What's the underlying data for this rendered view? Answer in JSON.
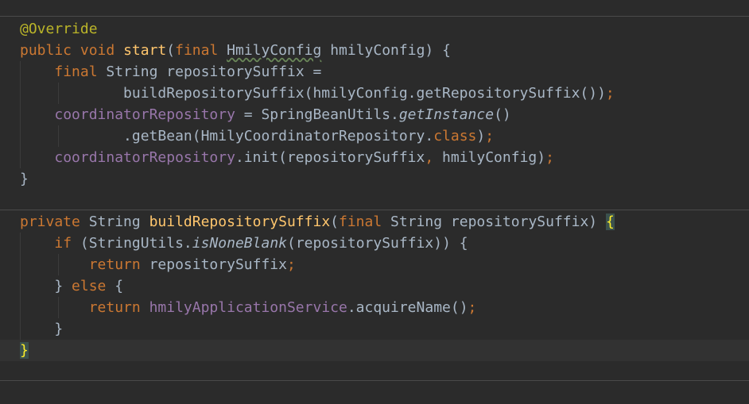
{
  "colors": {
    "background": "#2b2b2b",
    "current_line": "#323232",
    "text": "#a9b7c6",
    "keyword": "#cc7832",
    "annotation": "#bbb529",
    "method_declaration": "#ffc66d",
    "field": "#9876aa",
    "brace_match_bg": "#3b514d",
    "brace_match_fg": "#ffef28"
  },
  "code": {
    "annotation": "@Override",
    "kw_public": "public",
    "kw_void": "void",
    "start_method": "start",
    "kw_final": "final",
    "hmily_config_type": "HmilyConfig",
    "hmily_config_param": "hmilyConfig",
    "open_brace": "{",
    "close_brace": "}",
    "string_type": "String",
    "repository_suffix_var": "repositorySuffix",
    "build_suffix_call": "buildRepositorySuffix(hmilyConfig.getRepositorySuffix())",
    "coordinator_repository_field": "coordinatorRepository",
    "spring_bean_utils": "SpringBeanUtils.",
    "get_instance": "getInstance",
    "get_bean_call": ".getBean(HmilyCoordinatorRepository.",
    "kw_class": "class",
    "init_call": ".init(repositorySuffix",
    "init_arg2": " hmilyConfig)",
    "kw_private": "private",
    "build_suffix_method": "buildRepositorySuffix",
    "kw_if": "if",
    "string_utils": "(StringUtils.",
    "is_none_blank": "isNoneBlank",
    "is_none_blank_args": "(repositorySuffix)) {",
    "kw_return": "return",
    "kw_else": "else",
    "hmily_app_service_field": "hmilyApplicationService",
    "acquire_name_call": ".acquireName()"
  }
}
